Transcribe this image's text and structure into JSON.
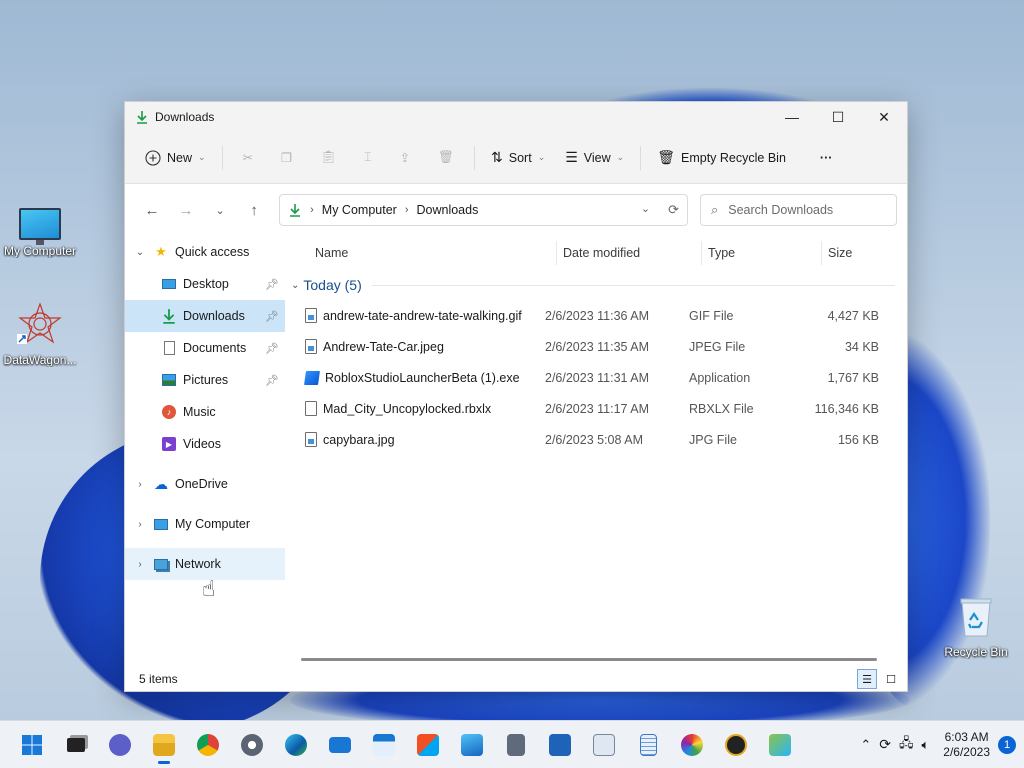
{
  "desktop": {
    "icons": [
      {
        "label": "My Computer"
      },
      {
        "label": "DataWagon..."
      },
      {
        "label": "Recycle Bin"
      }
    ]
  },
  "window": {
    "title": "Downloads",
    "controls": {
      "minimize": "—",
      "maximize": "☐",
      "close": "✕"
    }
  },
  "toolbar": {
    "new_label": "New",
    "sort_label": "Sort",
    "view_label": "View",
    "empty_recycle_label": "Empty Recycle Bin",
    "more_label": "···"
  },
  "address": {
    "crumbs": [
      "My Computer",
      "Downloads"
    ],
    "search_placeholder": "Search Downloads"
  },
  "nav": {
    "quick_access": "Quick access",
    "items": [
      {
        "label": "Desktop",
        "pinned": true
      },
      {
        "label": "Downloads",
        "pinned": true
      },
      {
        "label": "Documents",
        "pinned": true
      },
      {
        "label": "Pictures",
        "pinned": true
      },
      {
        "label": "Music",
        "pinned": false
      },
      {
        "label": "Videos",
        "pinned": false
      }
    ],
    "onedrive": "OneDrive",
    "my_computer": "My Computer",
    "network": "Network"
  },
  "columns": {
    "name": "Name",
    "date": "Date modified",
    "type": "Type",
    "size": "Size"
  },
  "group": {
    "label": "Today (5)"
  },
  "files": [
    {
      "name": "andrew-tate-andrew-tate-walking.gif",
      "date": "2/6/2023 11:36 AM",
      "type": "GIF File",
      "size": "4,427 KB",
      "icon": "image-file-icon"
    },
    {
      "name": "Andrew-Tate-Car.jpeg",
      "date": "2/6/2023 11:35 AM",
      "type": "JPEG File",
      "size": "34 KB",
      "icon": "image-file-icon"
    },
    {
      "name": "RobloxStudioLauncherBeta (1).exe",
      "date": "2/6/2023 11:31 AM",
      "type": "Application",
      "size": "1,767 KB",
      "icon": "roblox-app-icon"
    },
    {
      "name": "Mad_City_Uncopylocked.rbxlx",
      "date": "2/6/2023 11:17 AM",
      "type": "RBXLX File",
      "size": "116,346 KB",
      "icon": "blank-file-icon"
    },
    {
      "name": "capybara.jpg",
      "date": "2/6/2023 5:08 AM",
      "type": "JPG File",
      "size": "156 KB",
      "icon": "image-file-icon"
    }
  ],
  "status": {
    "items_count": "5 items"
  },
  "taskbar": {
    "time": "6:03 AM",
    "date": "2/6/2023",
    "notifications": "1"
  },
  "colors": {
    "accent": "#0a64d6",
    "selection": "#cce4f7",
    "download_green": "#1a9b4b"
  }
}
